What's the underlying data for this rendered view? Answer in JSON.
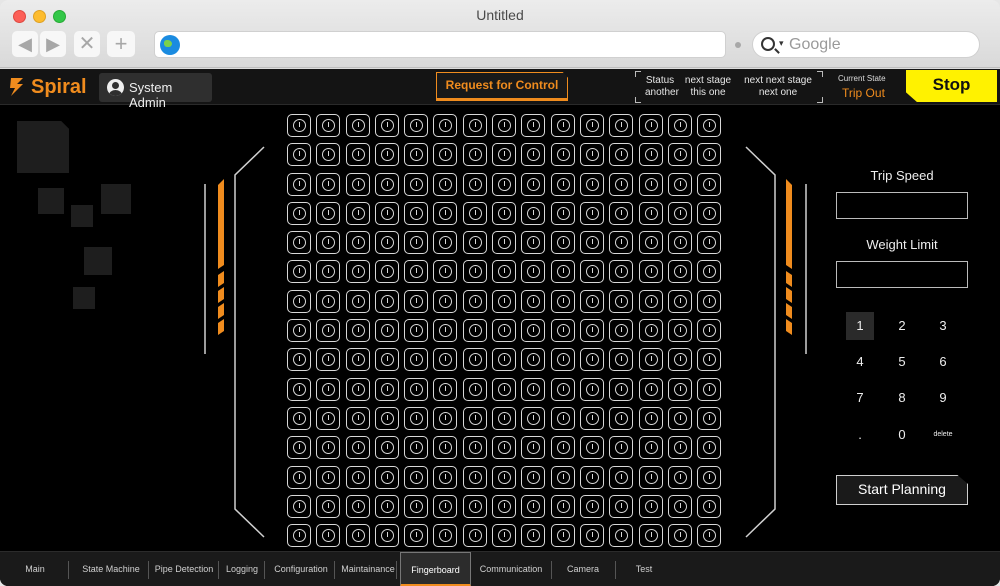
{
  "browser": {
    "title": "Untitled",
    "url": "",
    "search_placeholder": "Google",
    "back_icon": "◀",
    "forward_icon": "▶",
    "stop_icon": "✕",
    "add_icon": "+"
  },
  "app": {
    "brand": "Spiral",
    "user": "System Admin",
    "request_control": "Request for Control",
    "status_columns": [
      {
        "top": "Status",
        "bottom": "another"
      },
      {
        "top": "next stage",
        "bottom": "this one"
      },
      {
        "top": "next next stage",
        "bottom": "next one"
      }
    ],
    "current_state_label": "Current State",
    "current_state_value": "Trip Out",
    "stop_label": "Stop",
    "accent_color": "#f08c1e",
    "stop_color": "#fff200"
  },
  "fingerboard": {
    "rows": 15,
    "cols": 15,
    "cell_icon": "slot-icon"
  },
  "panel": {
    "trip_speed_label": "Trip Speed",
    "trip_speed_value": "",
    "weight_limit_label": "Weight Limit",
    "weight_limit_value": "",
    "keypad": [
      "1",
      "2",
      "3",
      "4",
      "5",
      "6",
      "7",
      "8",
      "9",
      ".",
      "0",
      "delete"
    ],
    "keypad_active": "1",
    "start_planning": "Start Planning"
  },
  "tabs": [
    {
      "label": "Main"
    },
    {
      "label": "State Machine"
    },
    {
      "label": "Pipe Detection"
    },
    {
      "label": "Logging"
    },
    {
      "label": "Configuration"
    },
    {
      "label": "Maintainance"
    },
    {
      "label": "Fingerboard",
      "active": true
    },
    {
      "label": "Communication"
    },
    {
      "label": "Camera"
    },
    {
      "label": "Test"
    }
  ]
}
